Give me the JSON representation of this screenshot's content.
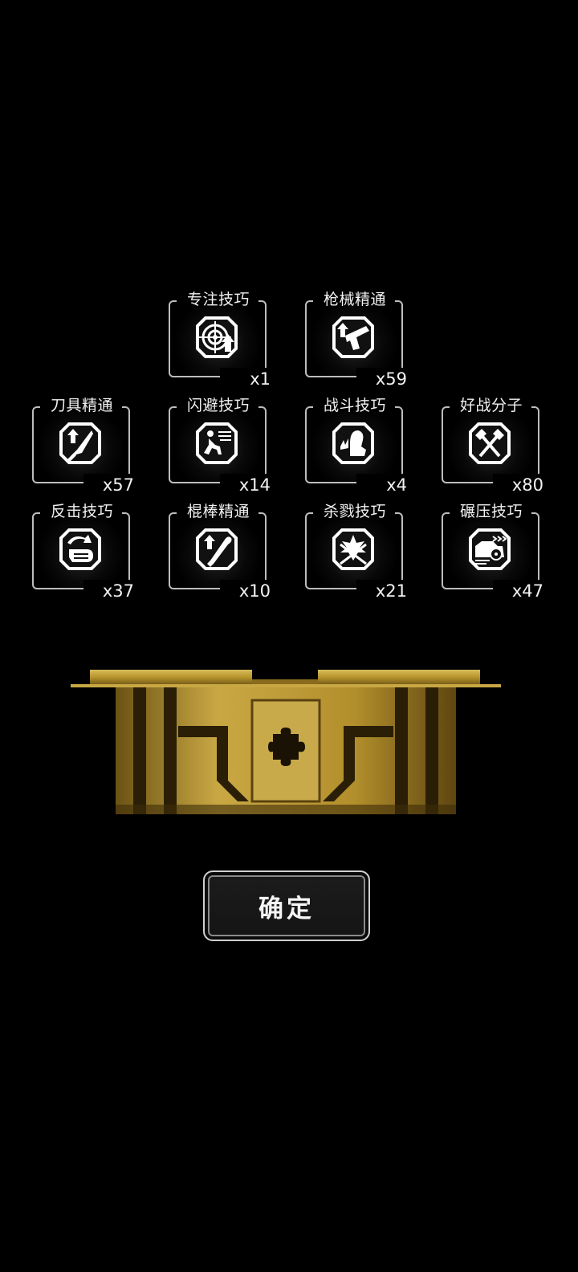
{
  "skills": [
    {
      "name": "专注技巧",
      "count": "x1",
      "icon": "focus-target-icon"
    },
    {
      "name": "枪械精通",
      "count": "x59",
      "icon": "pistol-icon"
    },
    {
      "name": "刀具精通",
      "count": "x57",
      "icon": "knife-icon"
    },
    {
      "name": "闪避技巧",
      "count": "x14",
      "icon": "dodge-runner-icon"
    },
    {
      "name": "战斗技巧",
      "count": "x4",
      "icon": "flexed-arm-icon"
    },
    {
      "name": "好战分子",
      "count": "x80",
      "icon": "crossed-axes-icon"
    },
    {
      "name": "反击技巧",
      "count": "x37",
      "icon": "counter-fist-icon"
    },
    {
      "name": "棍棒精通",
      "count": "x10",
      "icon": "baseball-bat-icon"
    },
    {
      "name": "杀戮技巧",
      "count": "x21",
      "icon": "crossed-blades-icon"
    },
    {
      "name": "碾压技巧",
      "count": "x47",
      "icon": "car-crush-icon"
    }
  ],
  "colors": {
    "frame": "#bdbdbd",
    "chest_gold": "#b8962e",
    "background": "#000000"
  },
  "chest": {
    "icon": "puzzle-piece-icon"
  },
  "confirm_button": {
    "label": "确定"
  }
}
